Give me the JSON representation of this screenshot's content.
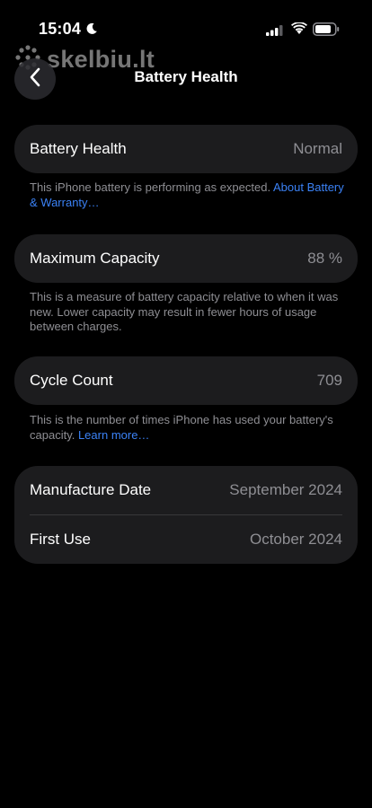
{
  "status_bar": {
    "time": "15:04"
  },
  "watermark": {
    "text": "skelbiu.lt"
  },
  "nav": {
    "title": "Battery Health"
  },
  "health": {
    "label": "Battery Health",
    "value": "Normal",
    "footnote": "This iPhone battery is performing as expected. ",
    "link": "About Battery & Warranty…"
  },
  "capacity": {
    "label": "Maximum Capacity",
    "value": "88 %",
    "footnote": "This is a measure of battery capacity relative to when it was new. Lower capacity may result in fewer hours of usage between charges."
  },
  "cycle": {
    "label": "Cycle Count",
    "value": "709",
    "footnote": "This is the number of times iPhone has used your battery's capacity. ",
    "link": "Learn more…"
  },
  "dates": {
    "manufacture_label": "Manufacture Date",
    "manufacture_value": "September 2024",
    "first_use_label": "First Use",
    "first_use_value": "October 2024"
  },
  "colors": {
    "background": "#000000",
    "card": "#1c1c1e",
    "secondary_text": "#8e8e93",
    "link": "#3b82f6"
  }
}
